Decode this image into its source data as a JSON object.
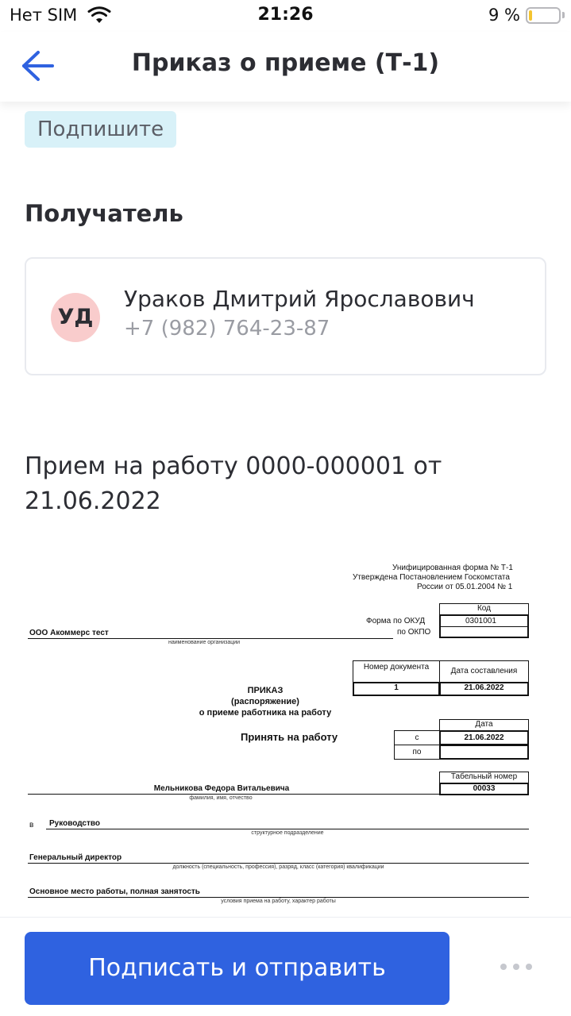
{
  "status_bar": {
    "carrier": "Нет SIM",
    "time": "21:26",
    "battery_text": "9 %"
  },
  "nav": {
    "title": "Приказ о приеме (Т-1)",
    "back_icon": "arrow-left-icon"
  },
  "status_badge": "Подпишите",
  "recipient_section": {
    "title": "Получатель",
    "initials": "УД",
    "name": "Ураков Дмитрий Ярославович",
    "phone": "+7 (982) 764-23-87"
  },
  "document": {
    "title": "Прием на работу 0000-000001 от 21.06.2022",
    "form": {
      "header_line1": "Унифицированная форма № Т-1",
      "header_line2": "Утверждена Постановлением Госкомстата",
      "header_line3": "России от 05.01.2004 № 1",
      "code_label": "Код",
      "okud_label": "Форма по ОКУД",
      "okud_value": "0301001",
      "okpo_label": "по ОКПО",
      "organization": "ООО Акоммерс тест",
      "organization_caption": "наименование организации",
      "doc_number_label": "Номер документа",
      "doc_date_label": "Дата составления",
      "doc_number": "1",
      "doc_date": "21.06.2022",
      "order_title": "ПРИКАЗ",
      "order_subtitle": "(распоряжение)",
      "order_subject": "о приеме работника на работу",
      "date_label": "Дата",
      "hire_label": "Принять на работу",
      "from_label": "с",
      "to_label": "по",
      "from_date": "21.06.2022",
      "tab_number_label": "Табельный номер",
      "tab_number": "00033",
      "employee_name": "Мельникова Федора Витальевича",
      "employee_caption": "фамилия, имя, отчество",
      "in_label": "в",
      "department": "Руководство",
      "department_caption": "структурное подразделение",
      "position": "Генеральный директор",
      "position_caption": "должность (специальность, профессия), разряд, класс (категория) квалификации",
      "conditions": "Основное место работы, полная занятость",
      "conditions_caption": "условия приема на работу, характер работы"
    }
  },
  "actions": {
    "primary_label": "Подписать и отправить",
    "more_icon": "more-dots-icon"
  }
}
